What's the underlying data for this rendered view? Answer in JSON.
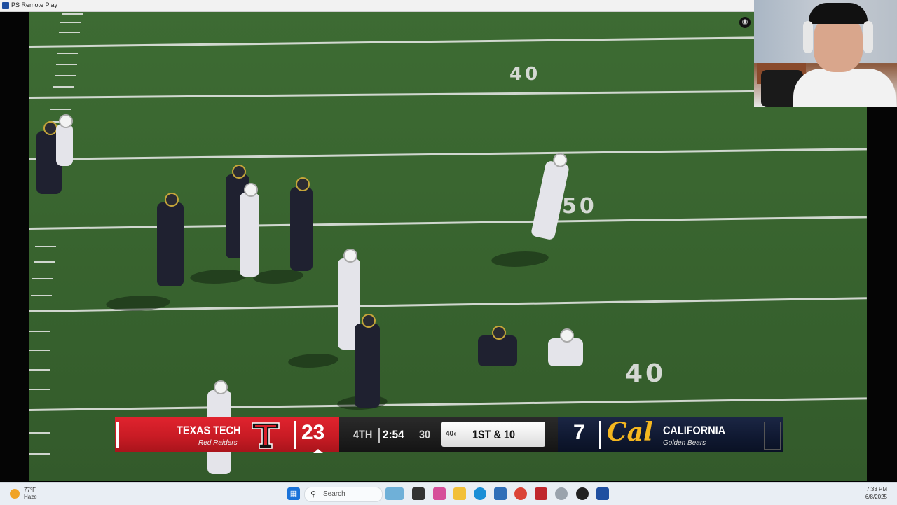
{
  "window": {
    "title": "PS Remote Play",
    "camera_icon": "camera-icon"
  },
  "field": {
    "yard_numbers": [
      "40",
      "50",
      "40"
    ]
  },
  "scorebug": {
    "home": {
      "name": "TEXAS TECH",
      "nickname": "Red Raiders",
      "score": "23",
      "logo": "double-t-logo",
      "color": "#c81b24"
    },
    "game": {
      "quarter": "4TH",
      "clock": "2:54",
      "play_clock": "30",
      "ball_on": "40‹",
      "down_distance": "1ST & 10"
    },
    "away": {
      "name": "CALIFORNIA",
      "nickname": "Golden Bears",
      "score": "7",
      "logo_text": "Cal",
      "color": "#f5b71f"
    }
  },
  "taskbar": {
    "weather_temp": "77°F",
    "weather_condition": "Haze",
    "search_placeholder": "Search",
    "time": "7:33 PM",
    "date": "6/8/2025",
    "icons": [
      "windows-start-icon",
      "search-icon",
      "copilot-icon",
      "task-view-icon",
      "colorful-app-icon",
      "file-explorer-icon",
      "edge-icon",
      "store-icon",
      "chrome-icon",
      "app-red-icon",
      "app-gray-icon",
      "obs-icon",
      "remote-play-icon"
    ]
  }
}
